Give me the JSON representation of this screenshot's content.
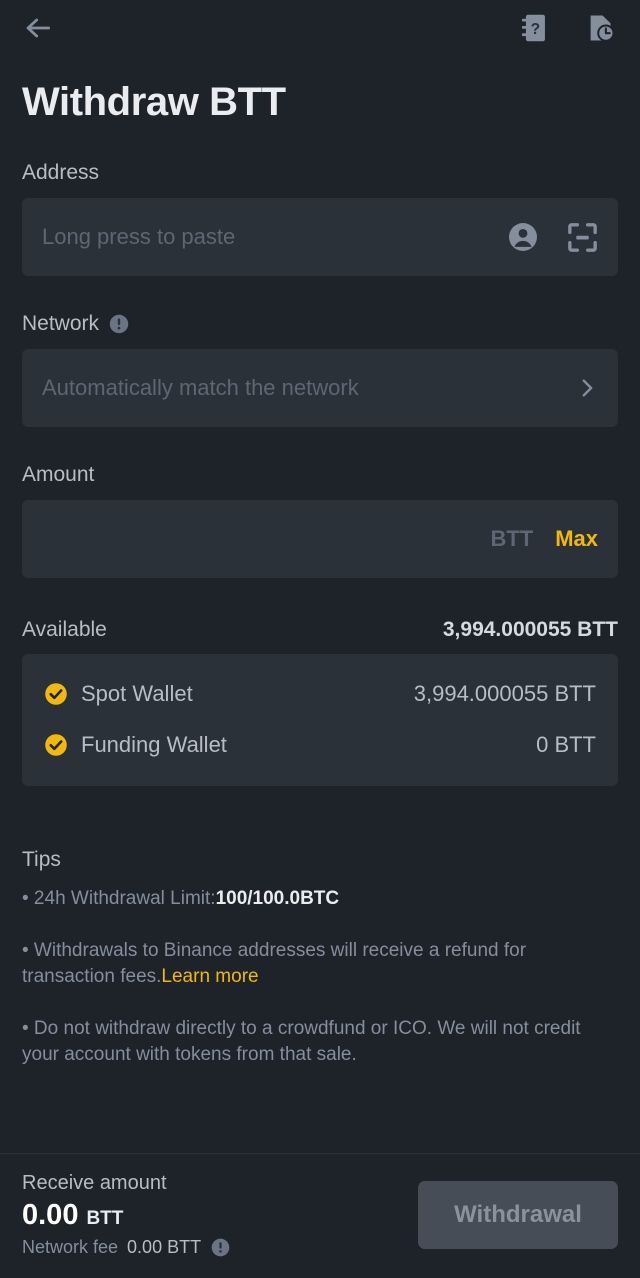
{
  "topbar": {
    "back_icon": "back-arrow-icon",
    "address_book_icon": "address-book-help-icon",
    "history_icon": "transaction-history-icon"
  },
  "header": {
    "title": "Withdraw BTT"
  },
  "address": {
    "label": "Address",
    "placeholder": "Long press to paste",
    "value": "",
    "contact_icon": "contact-person-icon",
    "scan_icon": "qr-scan-icon"
  },
  "network": {
    "label": "Network",
    "info_icon": "info-exclamation-icon",
    "placeholder": "Automatically match the network",
    "value": "",
    "chevron_icon": "chevron-right-icon"
  },
  "amount": {
    "label": "Amount",
    "placeholder": "",
    "value": "",
    "unit": "BTT",
    "max_label": "Max"
  },
  "available": {
    "label": "Available",
    "value": "3,994.000055 BTT",
    "wallets": [
      {
        "name": "Spot Wallet",
        "amount": "3,994.000055 BTT",
        "checked": true
      },
      {
        "name": "Funding Wallet",
        "amount": "0 BTT",
        "checked": true
      }
    ]
  },
  "tips": {
    "title": "Tips",
    "limit_prefix": "• 24h Withdrawal Limit:",
    "limit_value": "100/100.0BTC",
    "refund_text": "• Withdrawals to Binance addresses will receive a refund for transaction fees.",
    "refund_link": "Learn more",
    "ico_text": "• Do not withdraw directly to a crowdfund or ICO. We will not credit your account with tokens from that sale."
  },
  "bottom": {
    "receive_label": "Receive amount",
    "receive_amount": "0.00",
    "receive_unit": "BTT",
    "fee_label": "Network fee",
    "fee_value": "0.00 BTT",
    "fee_info_icon": "info-exclamation-icon",
    "withdraw_label": "Withdrawal"
  },
  "colors": {
    "background": "#1e2329",
    "surface": "#2b3139",
    "accent": "#f0b90b",
    "text_primary": "#eaecef",
    "text_secondary": "#b7bdc6",
    "text_muted": "#848e9c",
    "button_disabled": "#474d57"
  }
}
